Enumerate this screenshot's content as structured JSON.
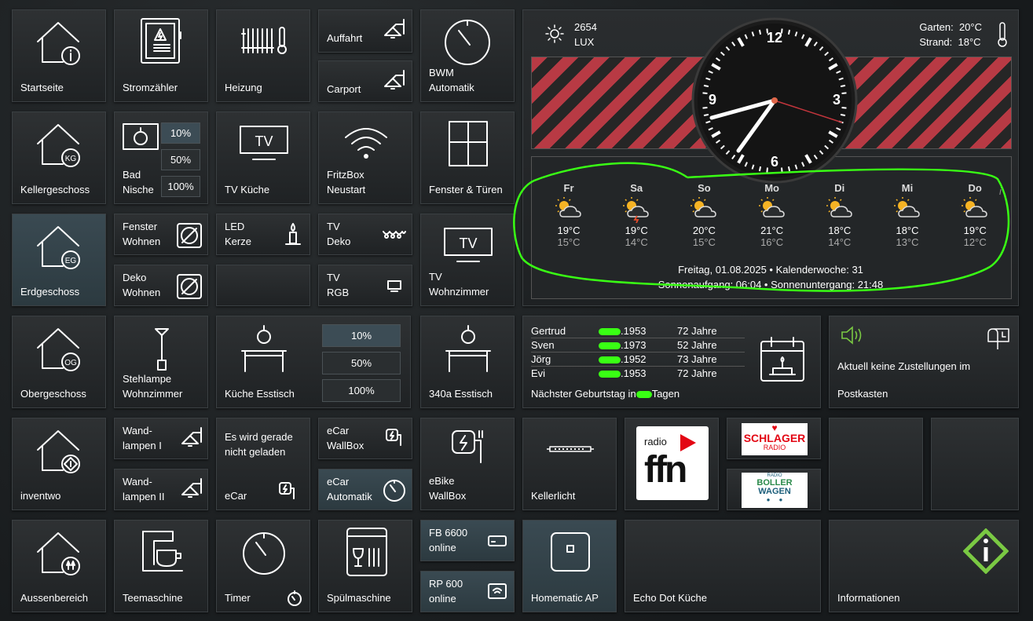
{
  "nav": {
    "startseite": "Startseite",
    "keller": "Kellergeschoss",
    "erdgeschoss": "Erdgeschoss",
    "obergeschoss": "Obergeschoss",
    "inventwo": "inventwo",
    "aussen": "Aussenbereich",
    "badge_keller": "KG",
    "badge_eg": "EG",
    "badge_og": "OG"
  },
  "tiles": {
    "stromzaehler": "Stromzähler",
    "heizung": "Heizung",
    "auffahrt": "Auffahrt",
    "carport": "Carport",
    "bwm": "BWM Automatik",
    "bad": "Bad Nische",
    "tv_kueche": "TV Küche",
    "fritzbox": "FritzBox Neustart",
    "fenster_tueren": "Fenster & Türen",
    "fenster_wohnen": "Fenster Wohnen",
    "led_kerze": "LED Kerze",
    "tv_deko": "TV Deko",
    "deko_wohnen": "Deko Wohnen",
    "tv_rgb": "TV RGB",
    "tv_wohnzimmer": "TV Wohnzimmer",
    "stehlampe": "Stehlampe Wohnzimmer",
    "kueche_esstisch": "Küche Esstisch",
    "esstisch_340a": "340a Esstisch",
    "wandlampen1": "Wand- lampen I",
    "wandlampen2": "Wand- lampen II",
    "ecar_status": "Es wird gerade nicht geladen",
    "ecar": "eCar",
    "ecar_wallbox": "eCar WallBox",
    "ecar_auto": "eCar Automatik",
    "ebike": "eBike WallBox",
    "kellerlicht": "Kellerlicht",
    "teemaschine": "Teemaschine",
    "timer": "Timer",
    "spuelmaschine": "Spülmaschine",
    "fb6600": "FB 6600 online",
    "rp600": "RP 600 online",
    "homematic": "Homematic AP",
    "echo": "Echo Dot Küche",
    "informationen": "Informationen",
    "tv_glyph": "TV"
  },
  "dim": {
    "p10": "10%",
    "p50": "50%",
    "p100": "100%"
  },
  "header": {
    "lux_value": "2654",
    "lux_unit": "LUX",
    "garten_label": "Garten:",
    "garten_value": "20°C",
    "strand_label": "Strand:",
    "strand_value": "18°C"
  },
  "clock": {
    "n12": "12",
    "n3": "3",
    "n6": "6",
    "n9": "9"
  },
  "weather": {
    "days": [
      {
        "day": "Fr",
        "hi": "19°C",
        "lo": "15°C"
      },
      {
        "day": "Sa",
        "hi": "19°C",
        "lo": "14°C"
      },
      {
        "day": "So",
        "hi": "20°C",
        "lo": "15°C"
      },
      {
        "day": "Mo",
        "hi": "21°C",
        "lo": "16°C"
      },
      {
        "day": "Di",
        "hi": "18°C",
        "lo": "14°C"
      },
      {
        "day": "Mi",
        "hi": "18°C",
        "lo": "13°C"
      },
      {
        "day": "Do",
        "hi": "19°C",
        "lo": "12°C"
      }
    ],
    "date_line": "Freitag, 01.08.2025 • Kalenderwoche: 31",
    "sun_line": "Sonnenaufgang: 06:04 • Sonnenuntergang: 21:48",
    "info_glyph": "i"
  },
  "birthdays": {
    "rows": [
      {
        "name": "Gertrud",
        "year": ".1953",
        "age": "72 Jahre"
      },
      {
        "name": "Sven",
        "year": ".1973",
        "age": "52 Jahre"
      },
      {
        "name": "Jörg",
        "year": ".1952",
        "age": "73 Jahre"
      },
      {
        "name": "Evi",
        "year": ".1953",
        "age": "72 Jahre"
      }
    ],
    "next_prefix": "Nächster Geburtstag in",
    "next_suffix": "Tagen"
  },
  "post": {
    "line1": "Aktuell keine Zustellungen im",
    "line2": "Postkasten"
  },
  "radio": {
    "ffn_top": "radio",
    "ffn_main": "ffn",
    "schlager_1": "SCHLAGER",
    "schlager_2": "RADIO",
    "boller_1": "RADIO",
    "boller_2": "BOLLER",
    "boller_3": "WAGEN"
  },
  "colors": {
    "stripe_red": "#b83a44",
    "active_blue": "#3c4c55",
    "highlight_green": "#39ff14",
    "info_green": "#7ac943"
  }
}
